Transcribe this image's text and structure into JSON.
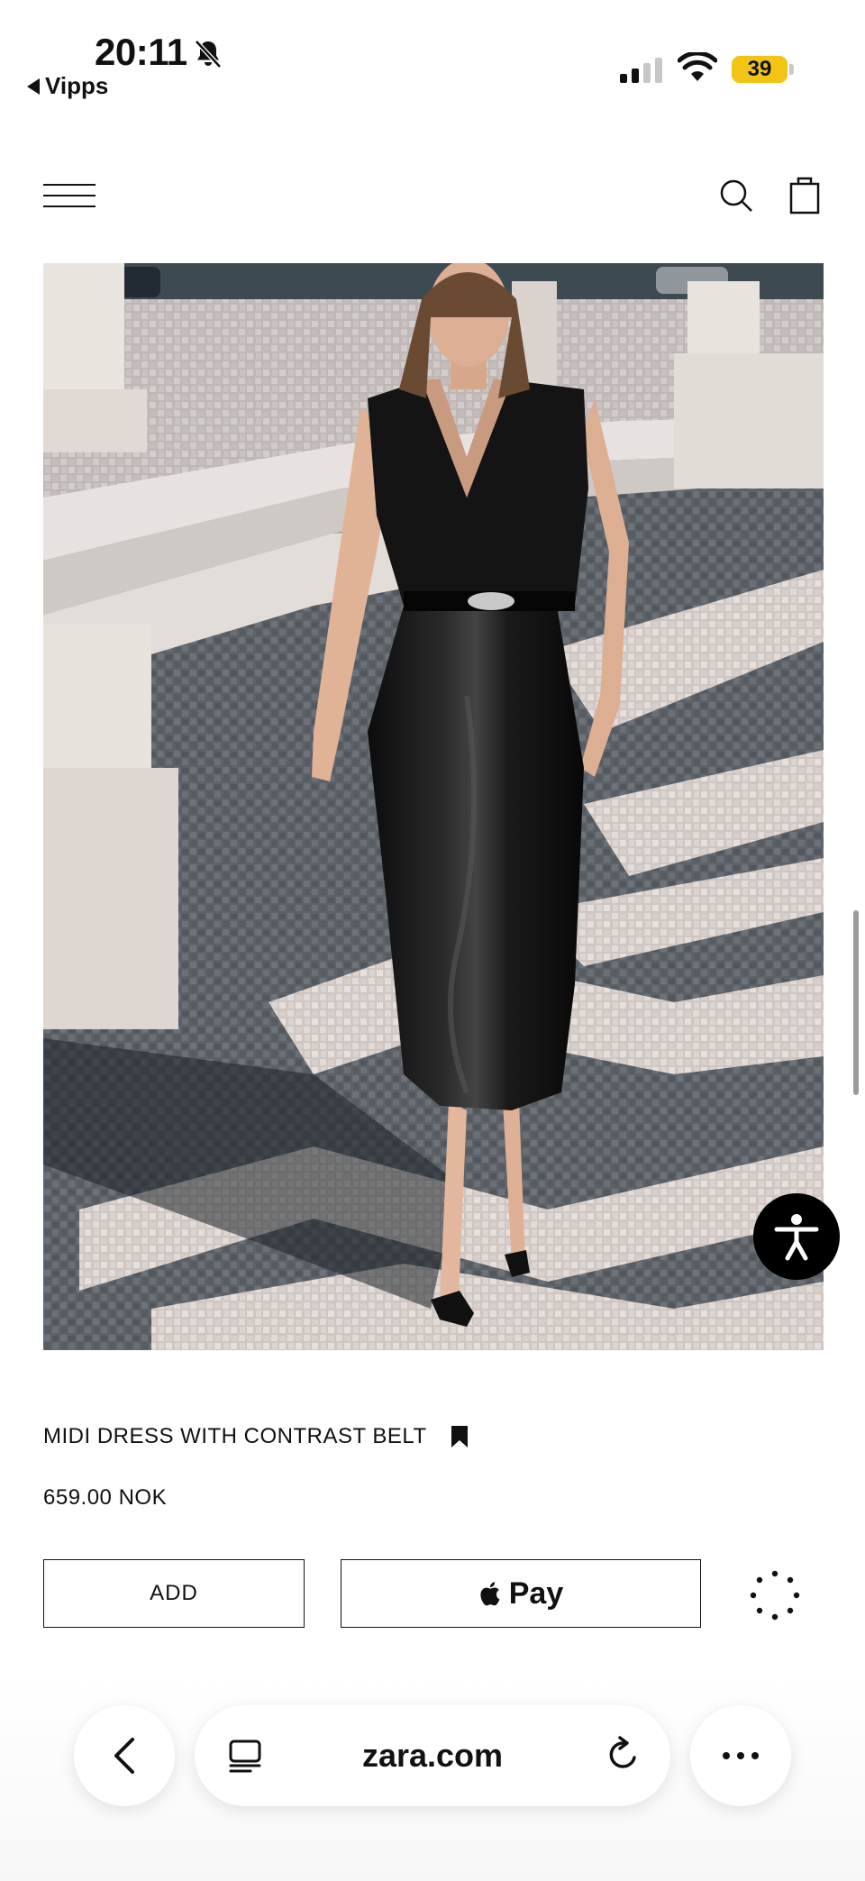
{
  "status_bar": {
    "time": "20:11",
    "back_app": "Vipps",
    "battery": "39",
    "icons": [
      "bell-slash-icon",
      "signal-icon",
      "wifi-icon",
      "battery-icon"
    ]
  },
  "header": {
    "icons": [
      "hamburger-menu-icon",
      "search-icon",
      "shopping-bag-icon"
    ]
  },
  "product": {
    "title": "MIDI DRESS WITH CONTRAST BELT",
    "price": "659.00 NOK",
    "add_label": "ADD",
    "pay_label": "Pay"
  },
  "browser": {
    "url": "zara.com",
    "icons": [
      "chevron-left-icon",
      "reader-icon",
      "reload-icon",
      "more-icon"
    ]
  },
  "colors": {
    "battery": "#f2c415",
    "text": "#111111",
    "background": "#ffffff"
  }
}
